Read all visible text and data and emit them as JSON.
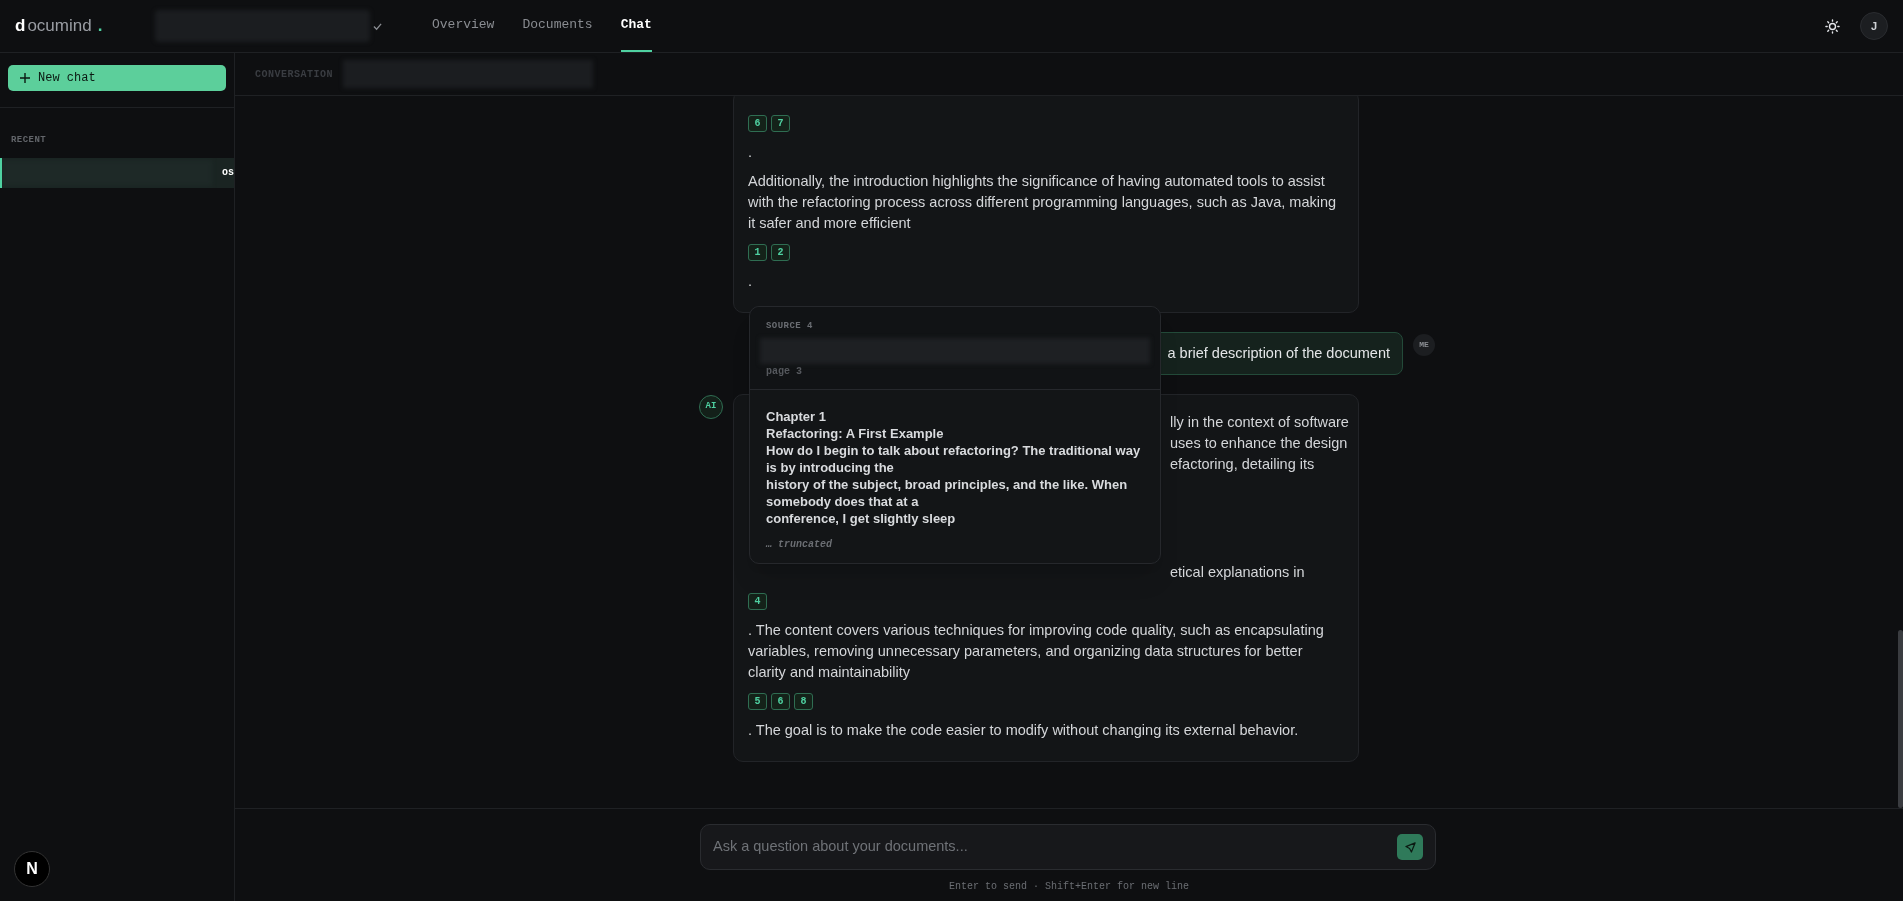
{
  "brand": {
    "initial": "d",
    "rest": "ocumind",
    "dot": "."
  },
  "nav": [
    {
      "label": "Overview",
      "selected": false
    },
    {
      "label": "Documents",
      "selected": false
    },
    {
      "label": "Chat",
      "selected": true
    }
  ],
  "user_avatar": "J",
  "sidebar": {
    "new_chat": "New chat",
    "section": "RECENT",
    "items": [
      {
        "label": "os",
        "selected": true
      }
    ]
  },
  "conversation_label": "CONVERSATION",
  "messages": [
    {
      "kind": "ai",
      "blocks": [
        {
          "kind": "cites",
          "items": [
            "6",
            "7"
          ]
        },
        {
          "kind": "text",
          "text": "."
        },
        {
          "kind": "text",
          "text": "Additionally, the introduction highlights the significance of having automated tools to assist with the refactoring process across different programming languages, such as Java, making it safer and more efficient"
        },
        {
          "kind": "cites",
          "items": [
            "1",
            "2"
          ]
        },
        {
          "kind": "text",
          "text": "."
        }
      ]
    },
    {
      "kind": "me",
      "avatar": "ME",
      "text": "a brief description of the document"
    },
    {
      "kind": "ai",
      "avatar": "AI",
      "blocks": [
        {
          "kind": "fragments",
          "lines": [
            "lly in the context of software",
            "uses to enhance the design",
            "efactoring, detailing its"
          ]
        },
        {
          "kind": "fragments",
          "lines": [
            "etical explanations in"
          ]
        },
        {
          "kind": "cites",
          "items": [
            "4"
          ]
        },
        {
          "kind": "text",
          "text": ". The content covers various techniques for improving code quality, such as encapsulating variables, removing unnecessary parameters, and organizing data structures for better clarity and maintainability"
        },
        {
          "kind": "cites",
          "items": [
            "5",
            "6",
            "8"
          ]
        },
        {
          "kind": "text",
          "text": ". The goal is to make the code easier to modify without changing its external behavior."
        }
      ]
    }
  ],
  "source_popover": {
    "title": "SOURCE 4",
    "page": "page 3",
    "lines": [
      "Chapter 1",
      "Refactoring: A First Example",
      "How do I begin to talk about refactoring? The traditional way is by introducing the",
      "history of the subject, broad principles, and the like. When somebody does that at a",
      "conference, I get slightly sleep"
    ],
    "truncated": "… truncated"
  },
  "composer": {
    "placeholder": "Ask a question about your documents...",
    "hint": "Enter to send · Shift+Enter for new line"
  },
  "dev_badge": "N"
}
